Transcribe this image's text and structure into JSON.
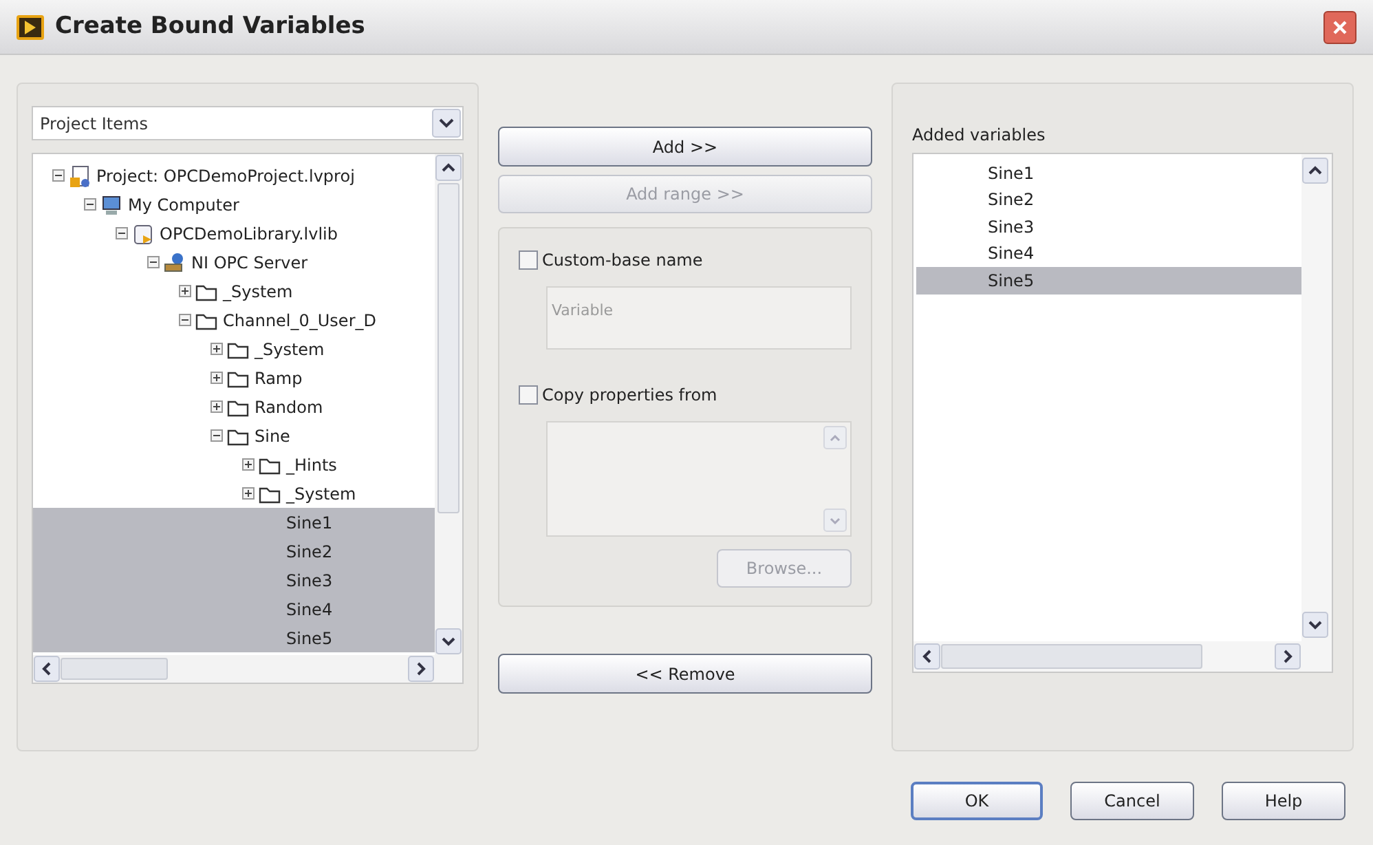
{
  "window": {
    "title": "Create Bound Variables"
  },
  "source": {
    "dropdown": "Project Items",
    "tree": [
      {
        "label": "Project: OPCDemoProject.lvproj",
        "kind": "project",
        "expanded": true,
        "selected": false,
        "children": [
          {
            "label": "My Computer",
            "kind": "computer",
            "expanded": true,
            "selected": false,
            "children": [
              {
                "label": "OPCDemoLibrary.lvlib",
                "kind": "library",
                "expanded": true,
                "selected": false,
                "children": [
                  {
                    "label": "NI OPC Server",
                    "kind": "server",
                    "expanded": true,
                    "selected": false,
                    "children": [
                      {
                        "label": "_System",
                        "kind": "folder",
                        "expanded": false,
                        "selected": false
                      },
                      {
                        "label": "Channel_0_User_D",
                        "kind": "folder",
                        "expanded": true,
                        "selected": false,
                        "children": [
                          {
                            "label": "_System",
                            "kind": "folder",
                            "expanded": false,
                            "selected": false
                          },
                          {
                            "label": "Ramp",
                            "kind": "folder",
                            "expanded": false,
                            "selected": false
                          },
                          {
                            "label": "Random",
                            "kind": "folder",
                            "expanded": false,
                            "selected": false
                          },
                          {
                            "label": "Sine",
                            "kind": "folder",
                            "expanded": true,
                            "selected": false,
                            "children": [
                              {
                                "label": "_Hints",
                                "kind": "folder",
                                "expanded": false,
                                "selected": false
                              },
                              {
                                "label": "_System",
                                "kind": "folder",
                                "expanded": false,
                                "selected": false
                              },
                              {
                                "label": "Sine1",
                                "selected": true
                              },
                              {
                                "label": "Sine2",
                                "selected": true
                              },
                              {
                                "label": "Sine3",
                                "selected": true
                              },
                              {
                                "label": "Sine4",
                                "selected": true
                              },
                              {
                                "label": "Sine5",
                                "selected": true
                              }
                            ]
                          }
                        ]
                      }
                    ]
                  }
                ]
              }
            ]
          }
        ]
      }
    ]
  },
  "actions": {
    "add": {
      "label": "Add >>",
      "disabled": false
    },
    "add_range": {
      "label": "Add range >>",
      "disabled": true
    },
    "custom_base_name": {
      "label": "Custom-base name",
      "checked": false,
      "value": "Variable"
    },
    "copy_properties": {
      "label": "Copy properties from",
      "checked": false
    },
    "browse": {
      "label": "Browse...",
      "disabled": true
    },
    "remove": {
      "label": "<< Remove",
      "disabled": false
    }
  },
  "added": {
    "label": "Added variables",
    "items": [
      {
        "label": "Sine1",
        "selected": false
      },
      {
        "label": "Sine2",
        "selected": false
      },
      {
        "label": "Sine3",
        "selected": false
      },
      {
        "label": "Sine4",
        "selected": false
      },
      {
        "label": "Sine5",
        "selected": true
      }
    ]
  },
  "buttons": [
    {
      "label": "OK",
      "default": true
    },
    {
      "label": "Cancel",
      "default": false
    },
    {
      "label": "Help",
      "default": false
    }
  ]
}
